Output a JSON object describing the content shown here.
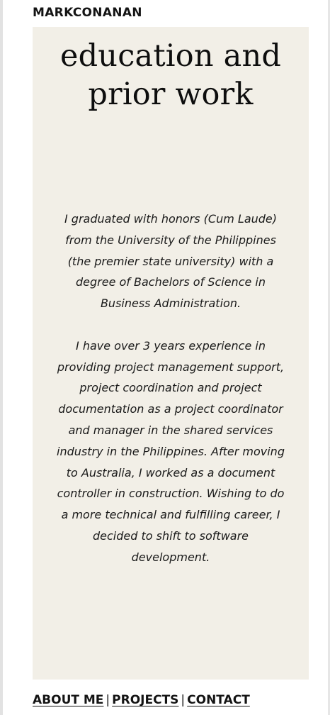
{
  "header": {
    "brand": "MARKCONANAN"
  },
  "main": {
    "heading": "education and prior work",
    "paragraphs": [
      "I graduated with honors (Cum Laude) from the University of the Philippines (the premier state university) with a degree of Bachelors of Science in Business Administration.",
      "I have over 3 years experience in providing project management support, project coordination and project documentation as a project coordinator and manager in the shared services industry in the Philippines. After moving to Australia, I worked as a document controller in construction. Wishing to do a more technical and fulfilling career, I decided to shift to software development."
    ]
  },
  "footer": {
    "links": [
      "ABOUT ME",
      "PROJECTS",
      "CONTACT"
    ],
    "separator": "|"
  }
}
